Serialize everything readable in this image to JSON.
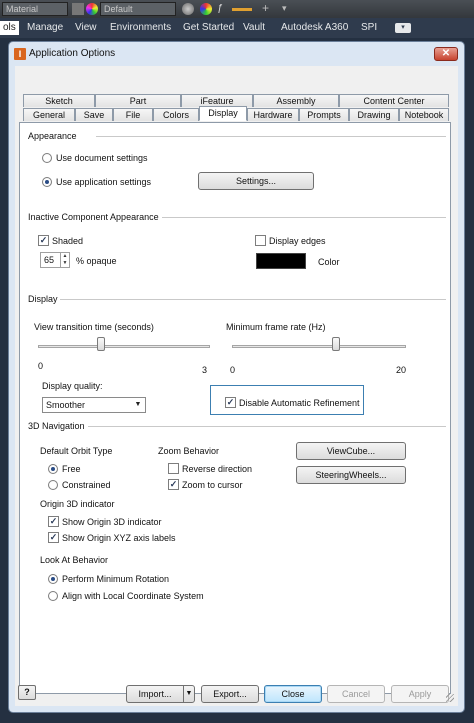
{
  "app": {
    "style_combo": "Material",
    "appearance_combo": "Default",
    "menu": [
      "ols",
      "Manage",
      "View",
      "Environments",
      "Get Started",
      "Vault",
      "Autodesk A360",
      "SPI"
    ]
  },
  "dialog": {
    "title": "Application Options",
    "close_glyph": "✕",
    "tabs_row1": [
      "Sketch",
      "Part",
      "iFeature",
      "Assembly",
      "Content Center"
    ],
    "tabs_row2": [
      "General",
      "Save",
      "File",
      "Colors",
      "Display",
      "Hardware",
      "Prompts",
      "Drawing",
      "Notebook"
    ],
    "selected_tab": "Display"
  },
  "appearance": {
    "title": "Appearance",
    "use_document": "Use document settings",
    "use_application": "Use application settings",
    "selected": "application",
    "settings_btn": "Settings..."
  },
  "inactive": {
    "title": "Inactive Component Appearance",
    "shaded": "Shaded",
    "shaded_checked": true,
    "display_edges": "Display edges",
    "display_edges_checked": false,
    "opacity_value": "65",
    "opacity_label": "% opaque",
    "color_label": "Color",
    "color_hex": "#000000"
  },
  "display": {
    "title": "Display",
    "view_transition": {
      "label": "View transition time (seconds)",
      "min": "0",
      "max": "3",
      "value": 1.1
    },
    "min_frame_rate": {
      "label": "Minimum frame rate (Hz)",
      "min": "0",
      "max": "20",
      "value": 12
    },
    "quality_label": "Display quality:",
    "quality_value": "Smoother",
    "disable_refinement": "Disable Automatic Refinement",
    "disable_refinement_checked": true
  },
  "nav3d": {
    "title": "3D Navigation",
    "orbit_title": "Default Orbit Type",
    "orbit_free": "Free",
    "orbit_constrained": "Constrained",
    "orbit_selected": "free",
    "zoom_title": "Zoom Behavior",
    "reverse_direction": "Reverse direction",
    "reverse_checked": false,
    "zoom_to_cursor": "Zoom to cursor",
    "zoom_checked": true,
    "viewcube_btn": "ViewCube...",
    "steeringwheels_btn": "SteeringWheels...",
    "origin_title": "Origin 3D indicator",
    "show_origin": "Show Origin 3D indicator",
    "show_origin_checked": true,
    "show_xyz": "Show Origin XYZ axis labels",
    "show_xyz_checked": true,
    "lookat_title": "Look At Behavior",
    "perform_min": "Perform Minimum Rotation",
    "align_local": "Align with Local Coordinate System",
    "lookat_selected": "minimum"
  },
  "footer": {
    "help": "?",
    "import_btn": "Import...",
    "export_btn": "Export...",
    "close_btn": "Close",
    "cancel_btn": "Cancel",
    "apply_btn": "Apply"
  }
}
